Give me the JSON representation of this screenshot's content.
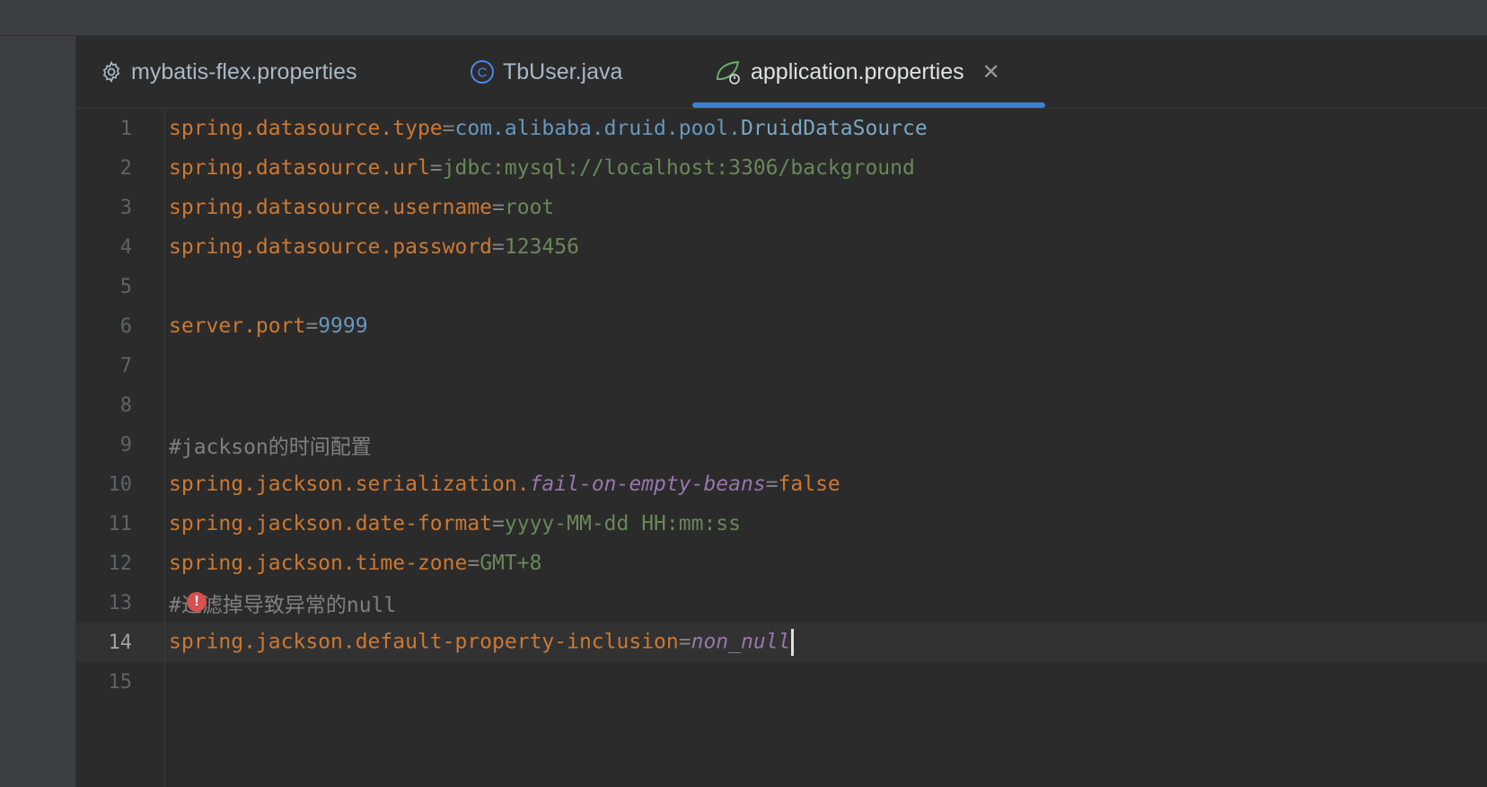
{
  "tabs": [
    {
      "label": "mybatis-flex.properties",
      "icon": "gear-icon"
    },
    {
      "label": "TbUser.java",
      "icon": "class-icon"
    },
    {
      "label": "application.properties",
      "icon": "spring-properties-icon",
      "active": true
    }
  ],
  "colors": {
    "accent": "#3d7fd6",
    "key": "#cc7832",
    "value": "#6a8759",
    "number": "#6897bb",
    "comment": "#808080",
    "italic_key": "#9876aa"
  },
  "lines": {
    "n1": "1",
    "n2": "2",
    "n3": "3",
    "n4": "4",
    "n5": "5",
    "n6": "6",
    "n7": "7",
    "n8": "8",
    "n9": "9",
    "n10": "10",
    "n11": "11",
    "n12": "12",
    "n13": "13",
    "n14": "14",
    "n15": "15",
    "l1_key": "spring.datasource.type",
    "l1_eq": "=",
    "l1_val_a": "com.alibaba.druid.pool.",
    "l1_val_b": "DruidDataSource",
    "l2_key": "spring.datasource.url",
    "l2_eq": "=",
    "l2_val": "jdbc:mysql://localhost:3306/background",
    "l3_key": "spring.datasource.username",
    "l3_eq": "=",
    "l3_val": "root",
    "l4_key": "spring.datasource.password",
    "l4_eq": "=",
    "l4_val": "123456",
    "l6_key": "server.port",
    "l6_eq": "=",
    "l6_val": "9999",
    "l9_comment": "#jackson的时间配置",
    "l10_key": "spring.jackson.serialization.",
    "l10_key_it": "fail-on-empty-beans",
    "l10_eq": "=",
    "l10_val": "false",
    "l11_key": "spring.jackson.date-format",
    "l11_eq": "=",
    "l11_val": "yyyy-MM-dd HH:mm:ss",
    "l12_key": "spring.jackson.time-zone",
    "l12_eq": "=",
    "l12_val": "GMT+8",
    "l13_comment": "#过滤掉导致异常的null",
    "l14_key": "spring.jackson.default-property-inclusion",
    "l14_eq": "=",
    "l14_val": "non_null"
  }
}
